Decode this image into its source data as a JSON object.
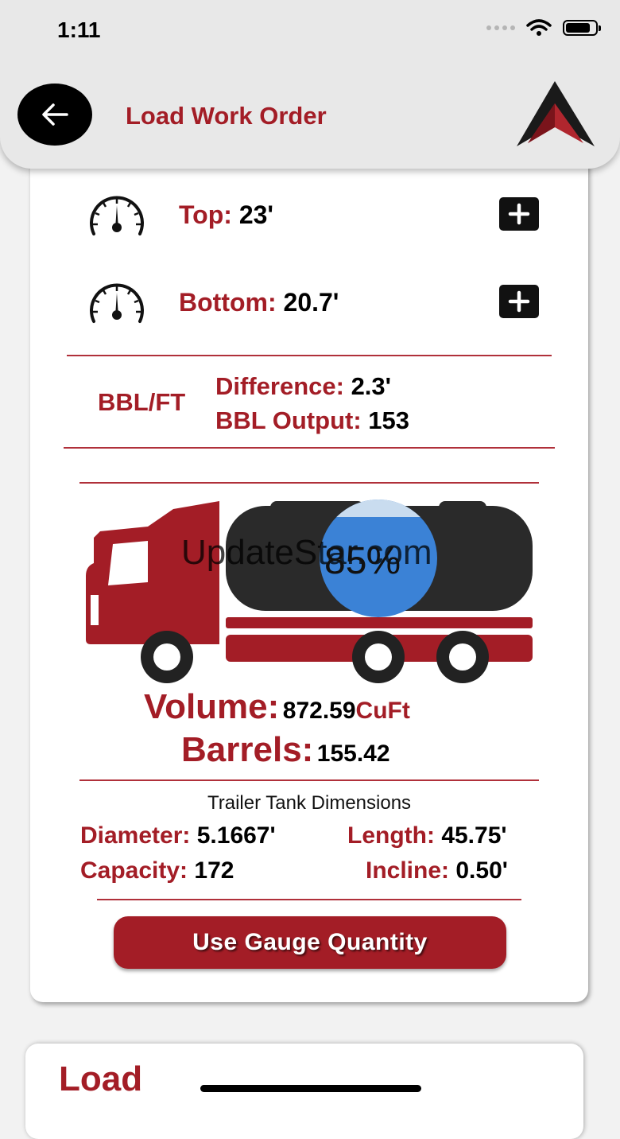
{
  "status_bar": {
    "time": "1:11"
  },
  "header": {
    "title": "Load Work Order"
  },
  "gauges": [
    {
      "label": "Top:",
      "value": "23'"
    },
    {
      "label": "Bottom:",
      "value": "20.7'"
    }
  ],
  "bbl": {
    "title": "BBL/FT",
    "difference_label": "Difference:",
    "difference_value": "2.3'",
    "output_label": "BBL Output:",
    "output_value": "153"
  },
  "tank": {
    "fill_percent_text": "85%",
    "fill_fraction": 0.85,
    "watermark": "UpdateStar.com"
  },
  "results": {
    "volume_label": "Volume:",
    "volume_value": "872.59",
    "volume_unit": "CuFt",
    "barrels_label": "Barrels:",
    "barrels_value": "155.42"
  },
  "dimensions": {
    "title": "Trailer Tank Dimensions",
    "diameter_label": "Diameter:",
    "diameter_value": "5.1667'",
    "length_label": "Length:",
    "length_value": "45.75'",
    "capacity_label": "Capacity:",
    "capacity_value": "172",
    "incline_label": "Incline:",
    "incline_value": "0.50'"
  },
  "actions": {
    "use_gauge_label": "Use Gauge Quantity"
  },
  "next_card": {
    "title": "Load"
  },
  "colors": {
    "accent": "#a31d26",
    "tank": "#2a2a2a",
    "liquid": "#3b82d6"
  }
}
